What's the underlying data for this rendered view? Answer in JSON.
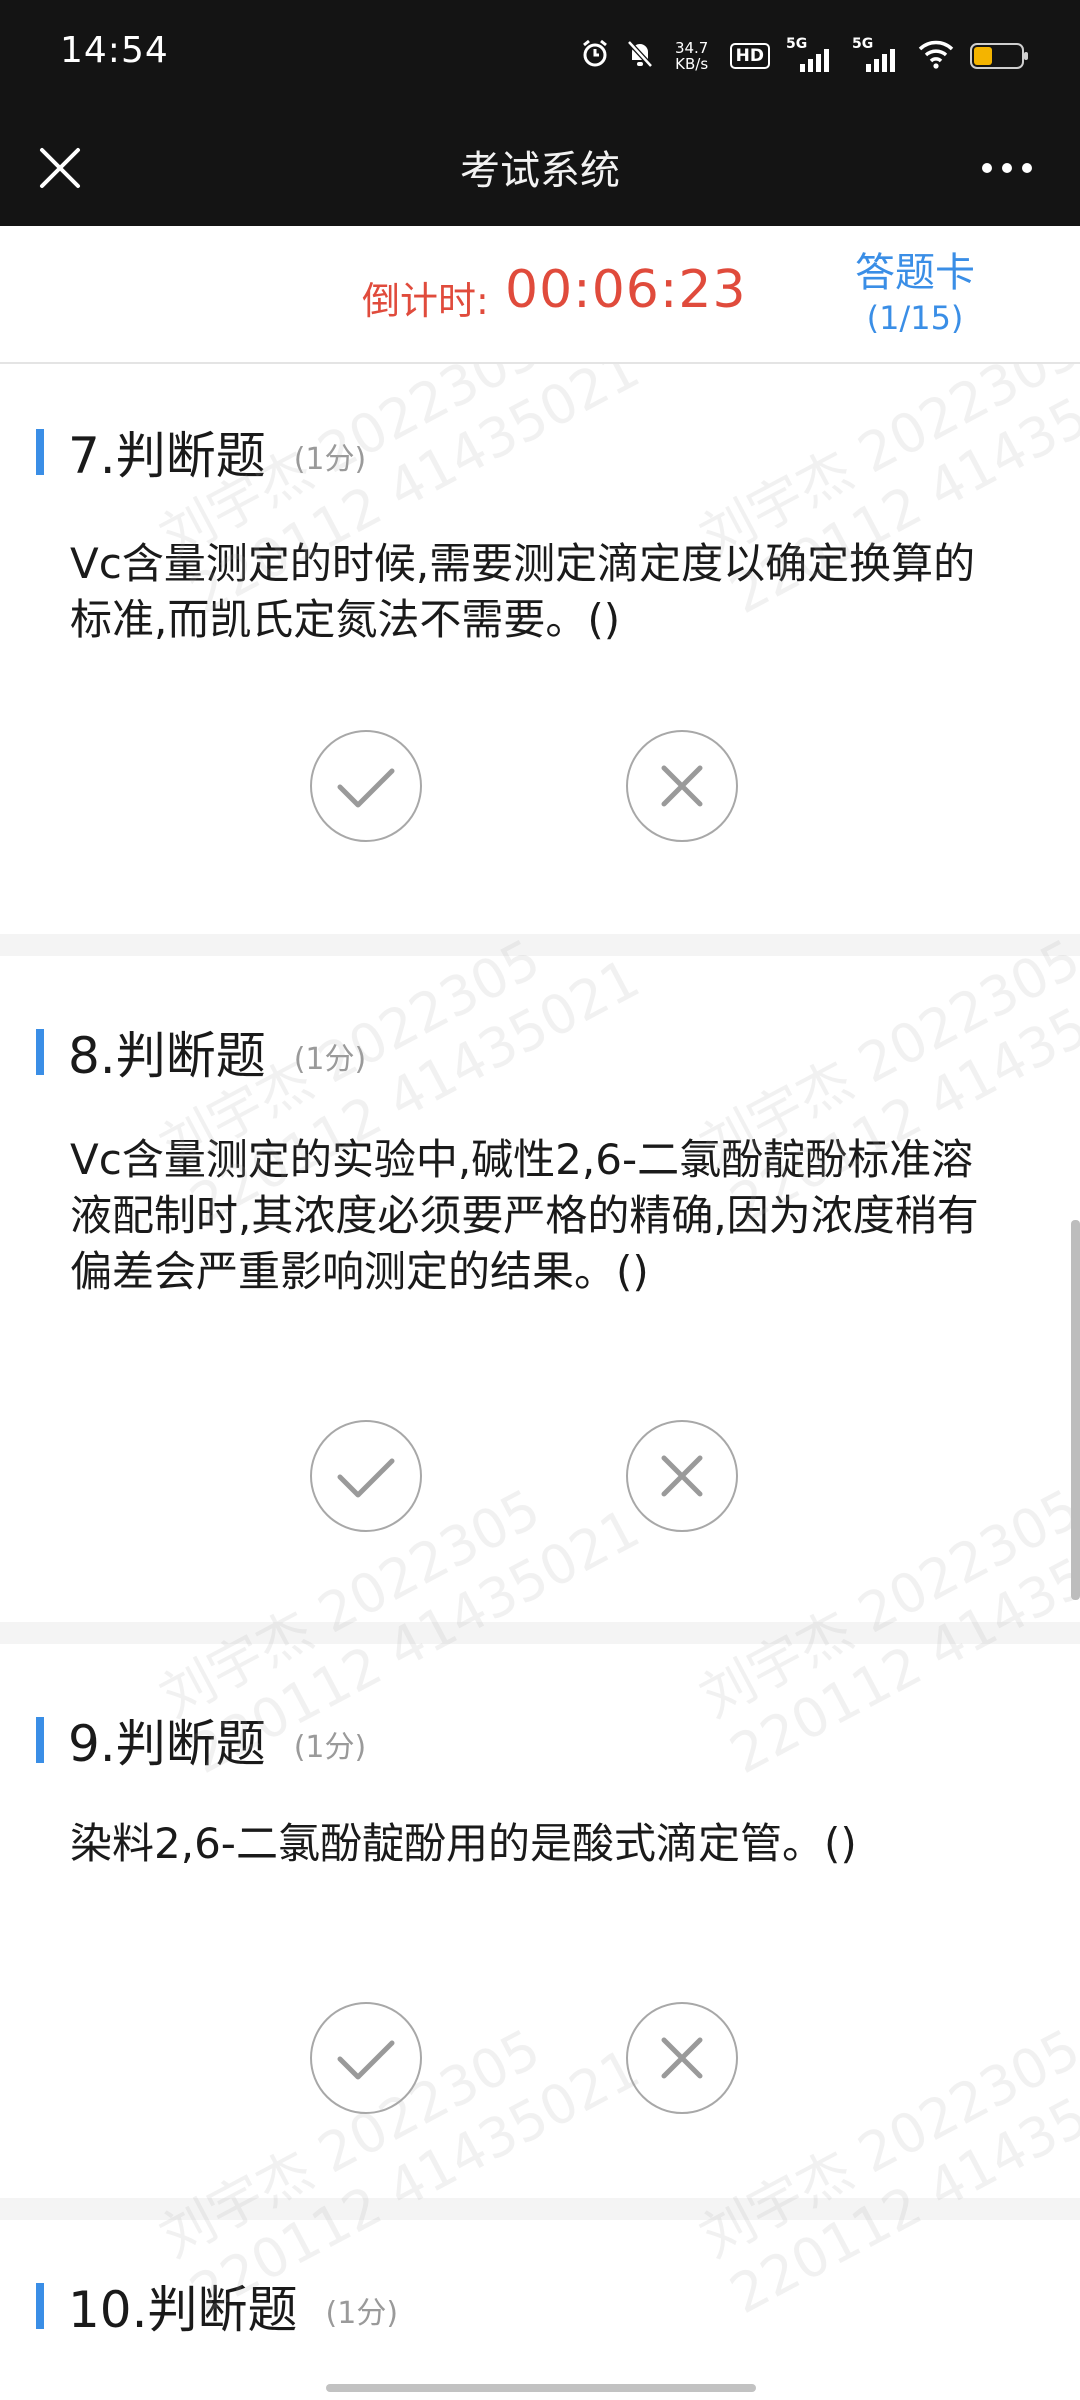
{
  "status_bar": {
    "time": "14:54",
    "net_speed_value": "34.7",
    "net_speed_unit": "KB/s",
    "hd_label": "HD",
    "sim1_label": "5G",
    "sim2_label": "5G",
    "battery_color": "#f4b400"
  },
  "header": {
    "title": "考试系统",
    "close_icon": "close-icon",
    "more_icon": "more-icon"
  },
  "timer": {
    "label": "倒计时:",
    "value": "00:06:23",
    "color": "#e04b3c"
  },
  "answer_card": {
    "label": "答题卡",
    "progress": "(1/15)",
    "color": "#3a8ee6"
  },
  "questions": [
    {
      "title": "7.判断题",
      "score": "(1分)",
      "text": "Vc含量测定的时候,需要测定滴定度以确定换算的标准,而凯氏定氮法不需要。()"
    },
    {
      "title": "8.判断题",
      "score": "(1分)",
      "text": "Vc含量测定的实验中,碱性2,6-二氯酚靛酚标准溶液配制时,其浓度必须要严格的精确,因为浓度稍有偏差会严重影响测定的结果。()"
    },
    {
      "title": "9.判断题",
      "score": "(1分)",
      "text": "染料2,6-二氯酚靛酚用的是酸式滴定管。()"
    },
    {
      "title": "10.判断题",
      "score": "(1分)"
    }
  ],
  "watermark": {
    "name_id": "刘宇杰 2022305",
    "number": "220112 41435021"
  }
}
